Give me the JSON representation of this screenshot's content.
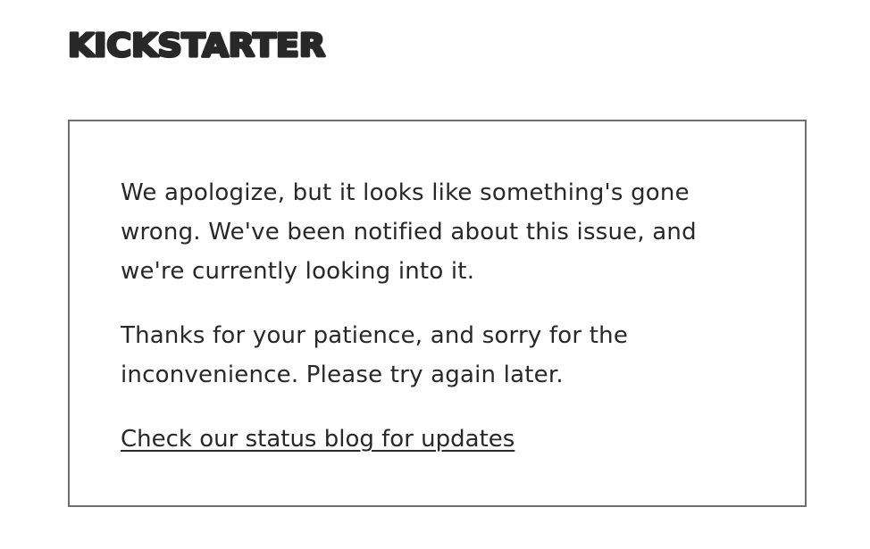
{
  "header": {
    "logo_text": "KICKSTARTER",
    "logo_icon": "kickstarter-wordmark"
  },
  "error_card": {
    "paragraph_1": "We apologize, but it looks like something's gone wrong. We've been notified about this issue, and we're currently looking into it.",
    "paragraph_2": "Thanks for your patience, and sorry for the inconvenience. Please try again later.",
    "status_link_label": "Check our status blog for updates"
  },
  "colors": {
    "text": "#282828",
    "border": "#6f6f6f",
    "background": "#ffffff"
  }
}
